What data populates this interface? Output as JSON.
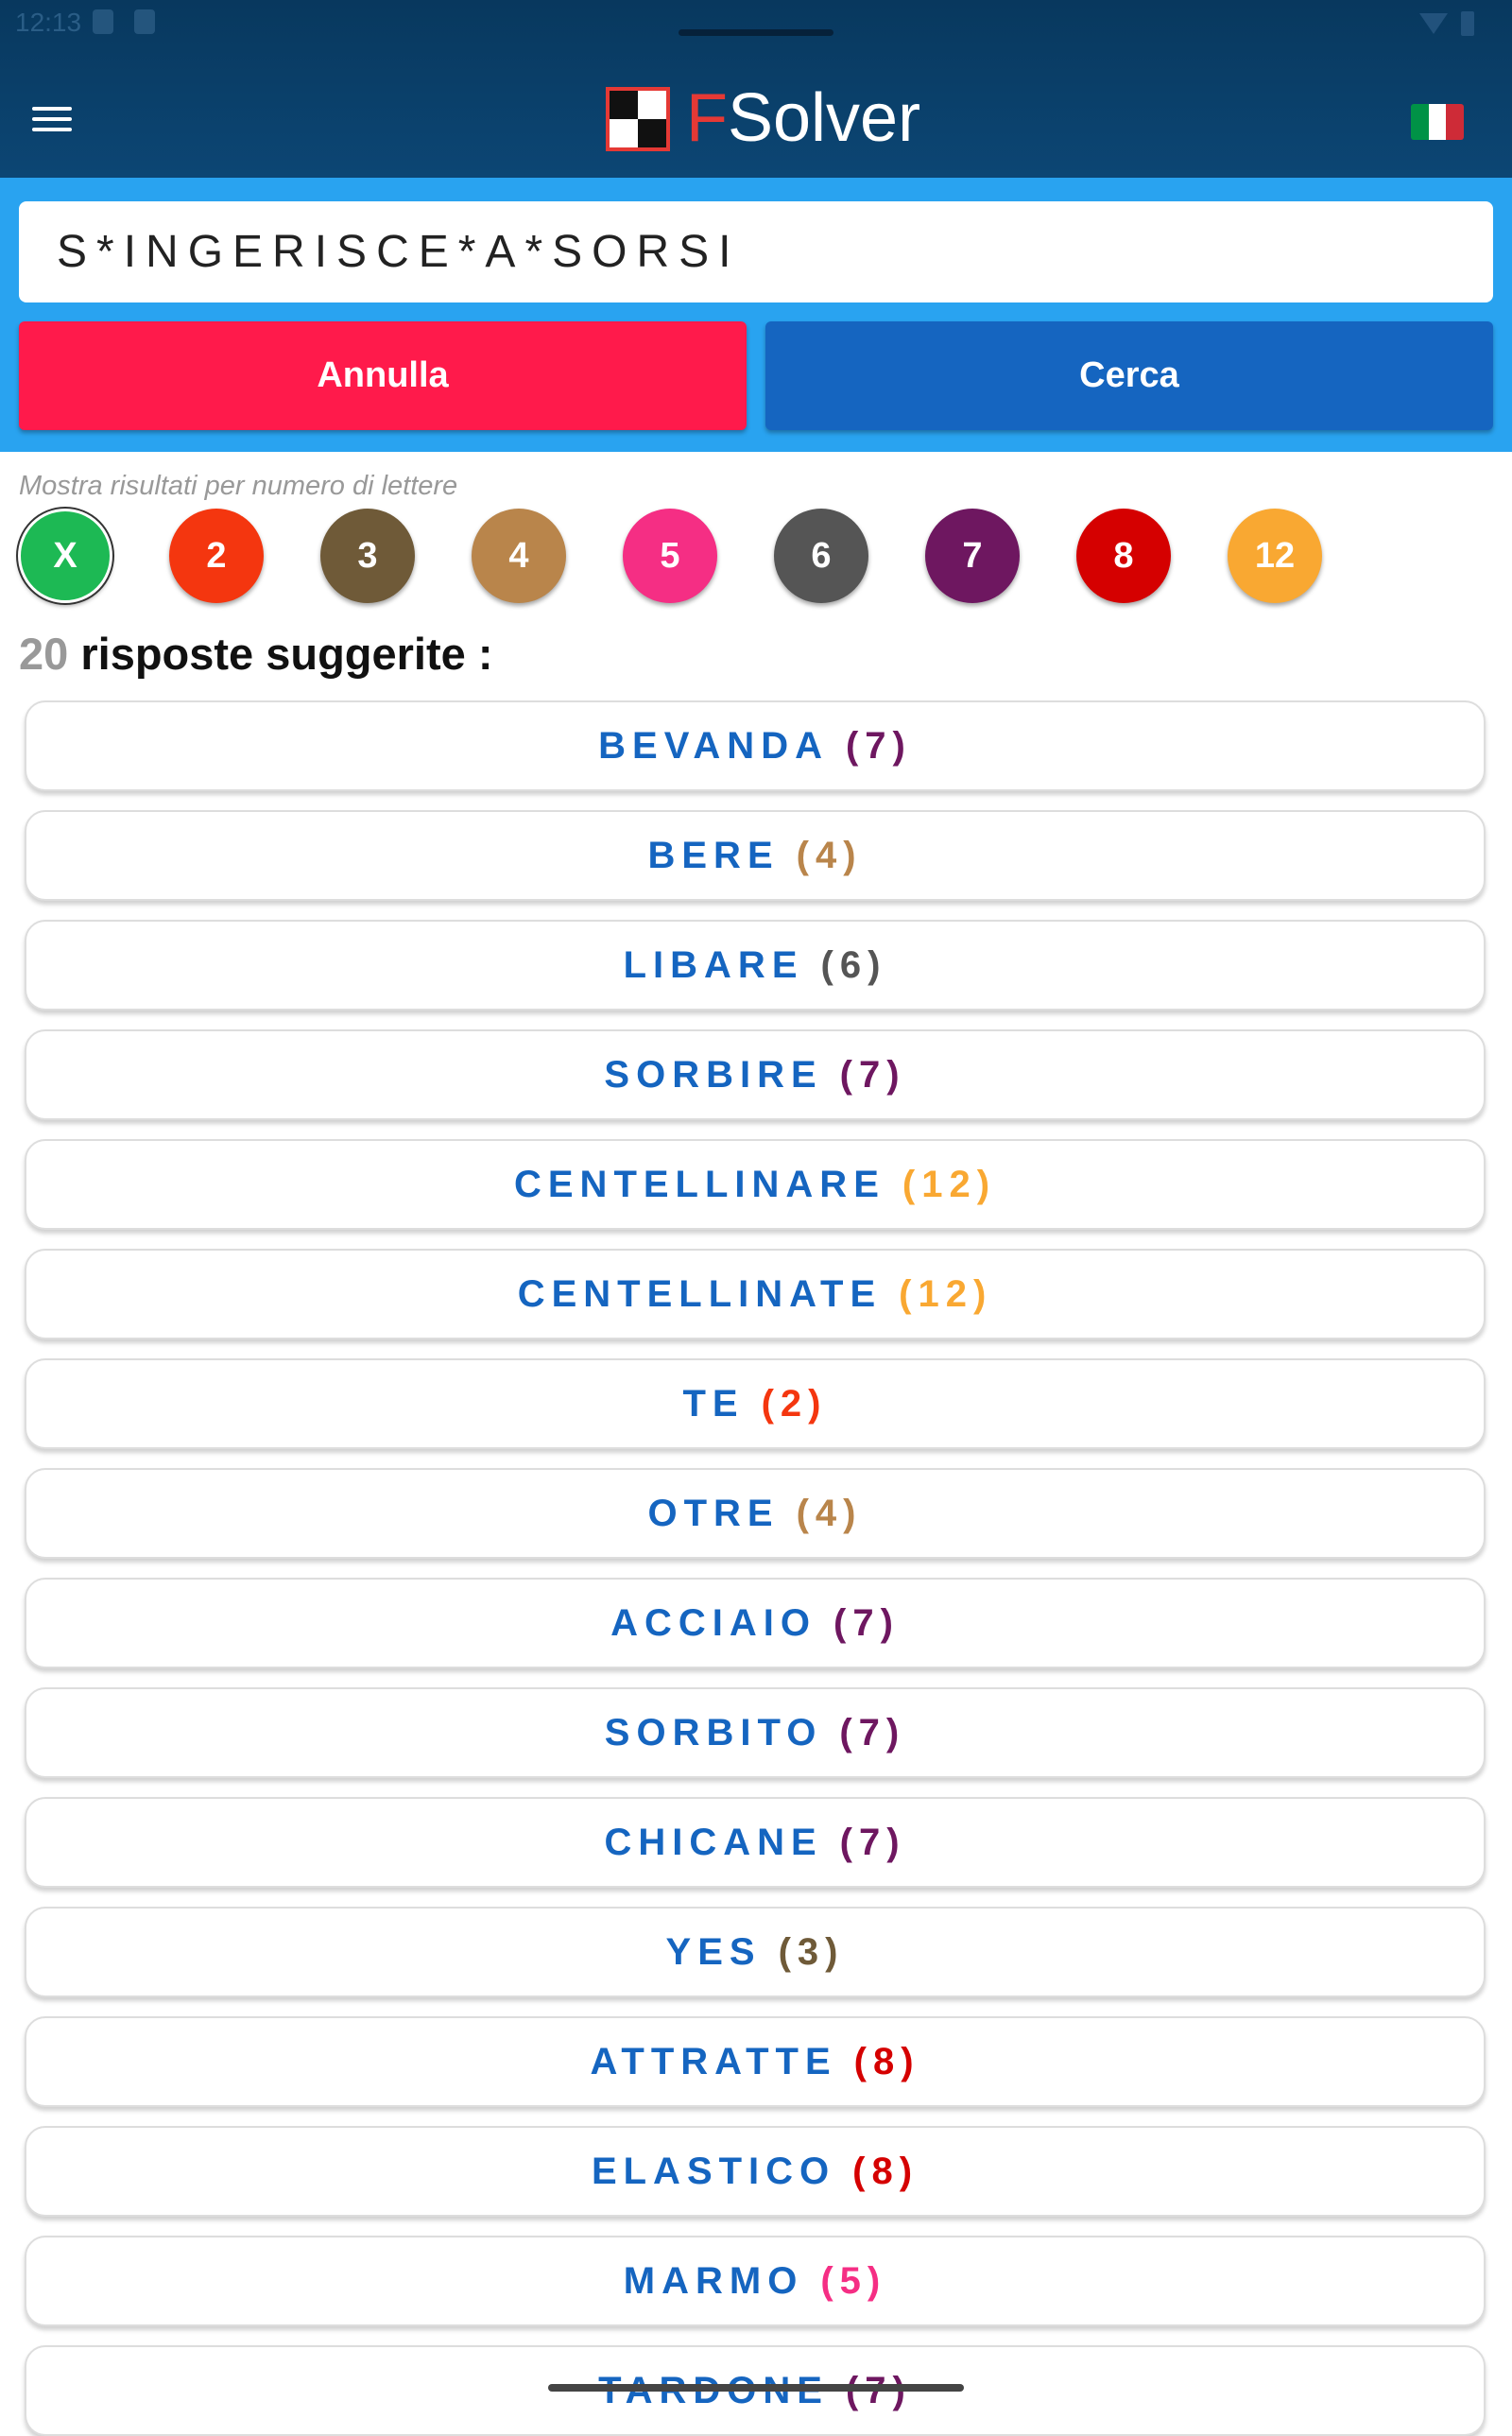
{
  "status_bar": {
    "time": "12:13"
  },
  "header": {
    "brand_f": "F",
    "brand_rest": "Solver",
    "flag_colors": [
      "#009246",
      "#ffffff",
      "#ce2b37"
    ]
  },
  "search": {
    "value": "S*INGERISCE*A*SORSI"
  },
  "buttons": {
    "cancel": "Annulla",
    "search": "Cerca"
  },
  "filter": {
    "caption": "Mostra risultati per numero di lettere",
    "items": [
      {
        "label": "X",
        "color": "#1db954",
        "active": true
      },
      {
        "label": "2",
        "color": "#f4360f"
      },
      {
        "label": "3",
        "color": "#6f5a38"
      },
      {
        "label": "4",
        "color": "#b9854b"
      },
      {
        "label": "5",
        "color": "#f52e84"
      },
      {
        "label": "6",
        "color": "#555555"
      },
      {
        "label": "7",
        "color": "#6e1760"
      },
      {
        "label": "8",
        "color": "#d50000"
      },
      {
        "label": "12",
        "color": "#f9a832"
      }
    ]
  },
  "results_header": {
    "count": "20",
    "text": " risposte suggerite :"
  },
  "results": [
    {
      "word": "BEVANDA",
      "n": "(7)",
      "color": "#6e1760"
    },
    {
      "word": "BERE",
      "n": "(4)",
      "color": "#b9854b"
    },
    {
      "word": "LIBARE",
      "n": "(6)",
      "color": "#555555"
    },
    {
      "word": "SORBIRE",
      "n": "(7)",
      "color": "#6e1760"
    },
    {
      "word": "CENTELLINARE",
      "n": "(12)",
      "color": "#f9a832"
    },
    {
      "word": "CENTELLINATE",
      "n": "(12)",
      "color": "#f9a832"
    },
    {
      "word": "TE",
      "n": "(2)",
      "color": "#f4360f"
    },
    {
      "word": "OTRE",
      "n": "(4)",
      "color": "#b9854b"
    },
    {
      "word": "ACCIAIO",
      "n": "(7)",
      "color": "#6e1760"
    },
    {
      "word": "SORBITO",
      "n": "(7)",
      "color": "#6e1760"
    },
    {
      "word": "CHICANE",
      "n": "(7)",
      "color": "#6e1760"
    },
    {
      "word": "YES",
      "n": "(3)",
      "color": "#6f5a38"
    },
    {
      "word": "ATTRATTE",
      "n": "(8)",
      "color": "#d50000"
    },
    {
      "word": "ELASTICO",
      "n": "(8)",
      "color": "#d50000"
    },
    {
      "word": "MARMO",
      "n": "(5)",
      "color": "#f52e84"
    },
    {
      "word": "TARDONE",
      "n": "(7)",
      "color": "#6e1760"
    }
  ]
}
